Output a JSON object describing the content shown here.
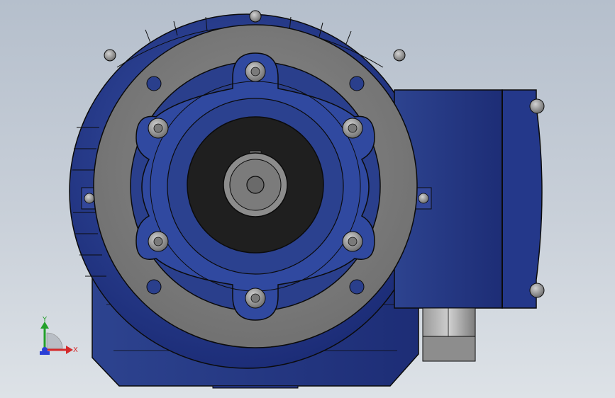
{
  "viewport": {
    "background_top": "#b5bfcc",
    "background_bottom": "#dde2e7"
  },
  "colors": {
    "housing_blue": "#2a3f8c",
    "housing_dark": "#132264",
    "housing_light": "#4a63b8",
    "flange_grey": "#7e7e7e",
    "bore_black": "#1f1f1f",
    "shaft_grey": "#8c8c8c",
    "bolt_grey": "#9a9a9a",
    "edge_black": "#0b0b0b"
  },
  "model": {
    "name": "worm-gear-reducer",
    "view": "front"
  },
  "triad": {
    "x_label": "X",
    "y_label": "Y",
    "x_color": "#d42a2a",
    "y_color": "#23a02a",
    "z_color": "#2a3fd6"
  }
}
